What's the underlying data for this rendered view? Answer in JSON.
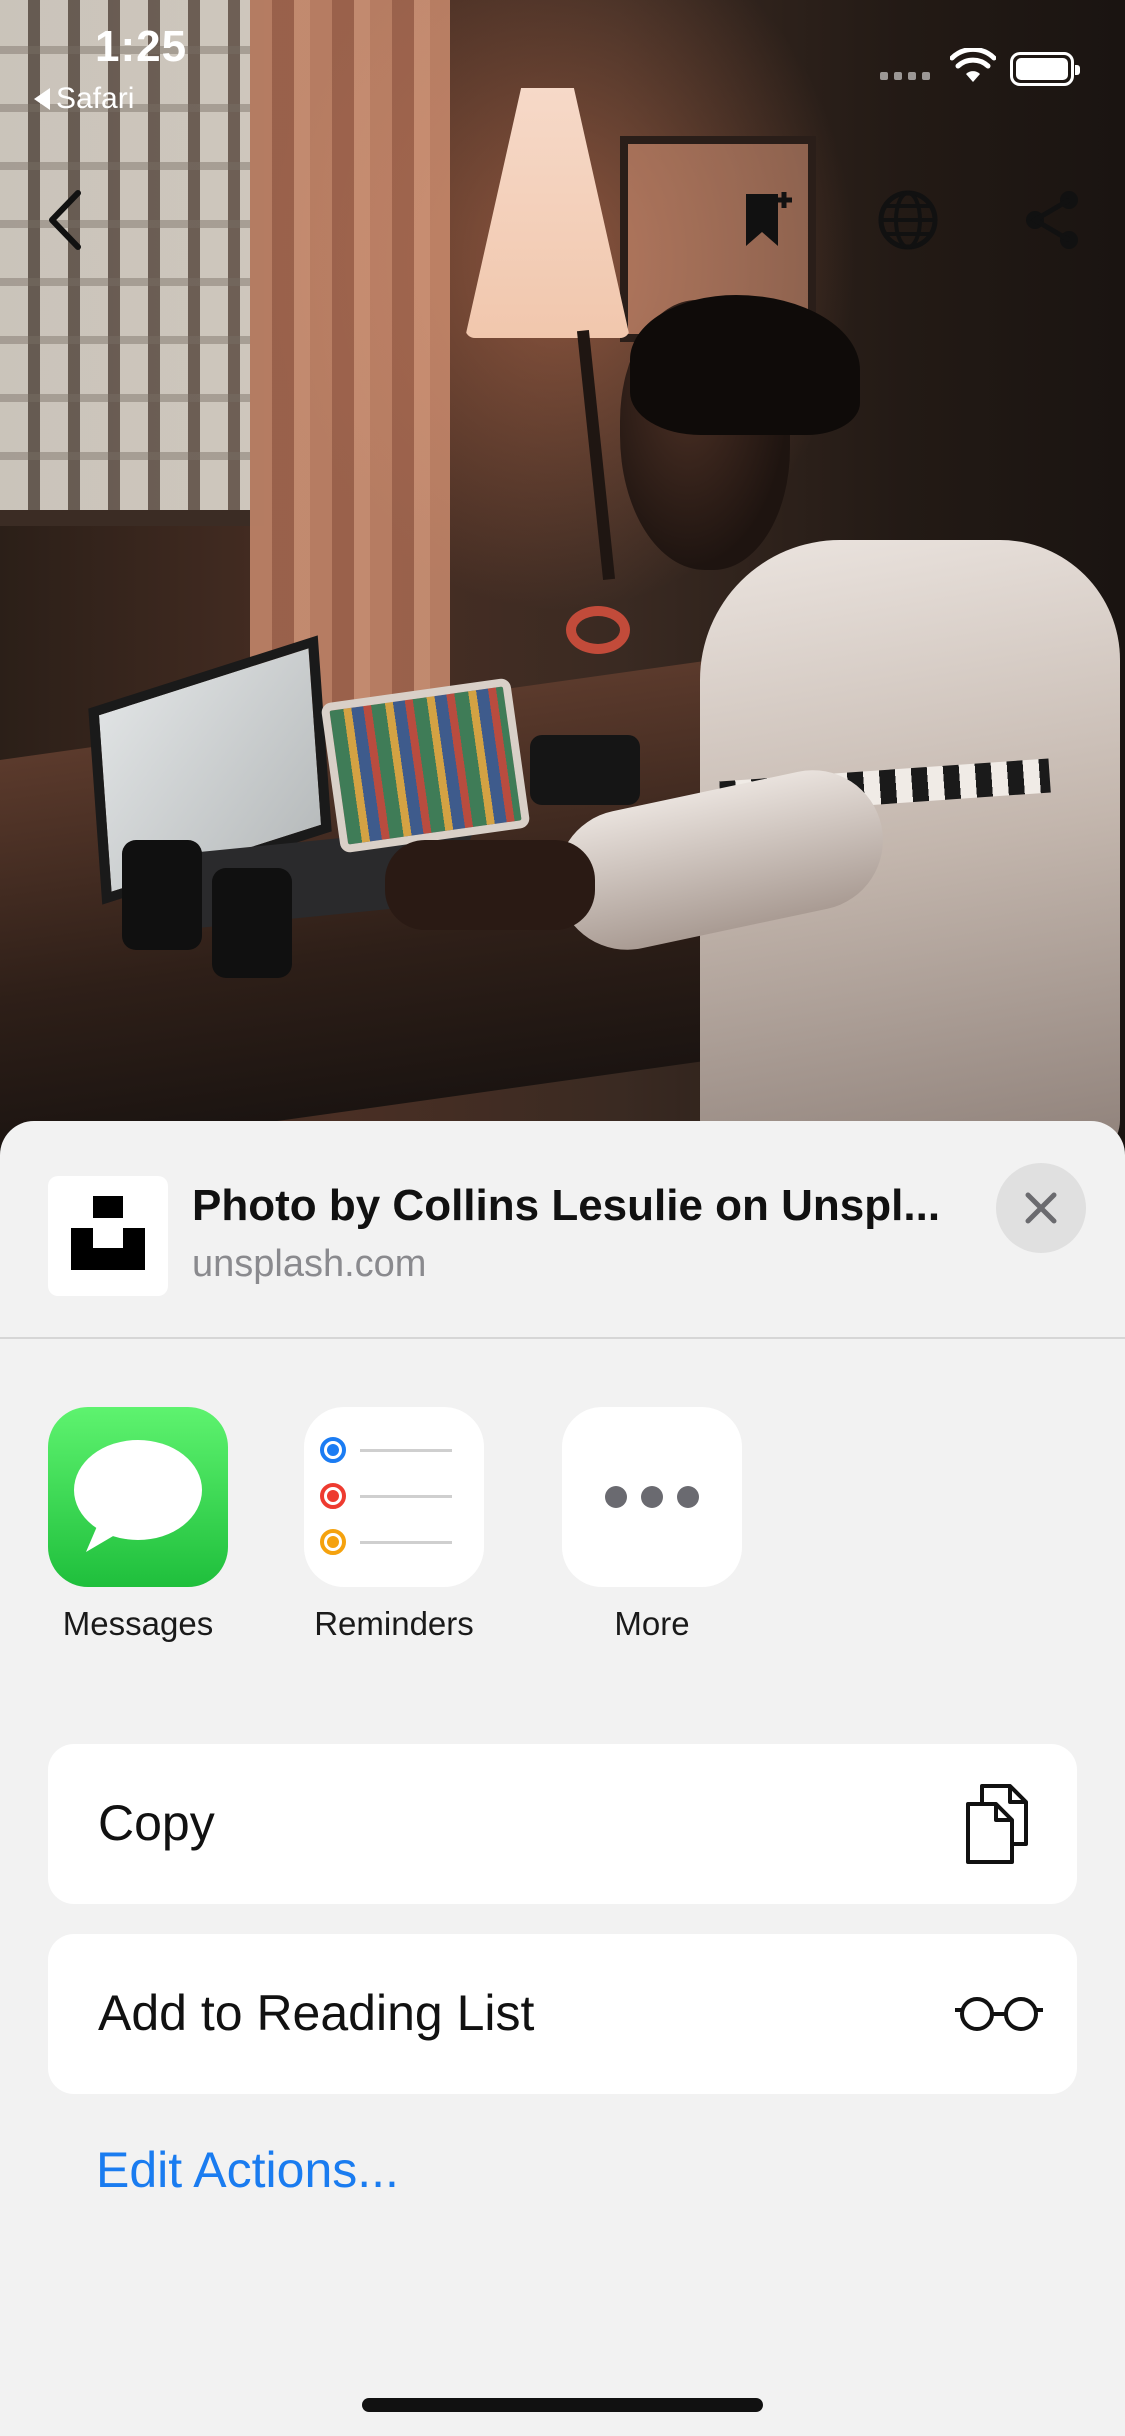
{
  "status_bar": {
    "time": "1:25",
    "back_app": "Safari"
  },
  "photo_toolbar": {
    "icons": [
      "back-chevron-icon",
      "bookmark-add-icon",
      "globe-icon",
      "share-icon"
    ]
  },
  "share_sheet": {
    "title": "Photo by Collins Lesulie on Unspl...",
    "url": "unsplash.com",
    "apps": [
      {
        "label": "Messages",
        "icon": "messages-icon"
      },
      {
        "label": "Reminders",
        "icon": "reminders-icon"
      },
      {
        "label": "More",
        "icon": "more-icon"
      }
    ],
    "actions": [
      {
        "label": "Copy",
        "icon": "copy-icon"
      },
      {
        "label": "Add to Reading List",
        "icon": "reading-list-glasses-icon"
      }
    ],
    "edit_actions": "Edit Actions..."
  },
  "colors": {
    "accent": "#1a7cf0",
    "messages_green": "#2ccf4a",
    "reminder_blue": "#1b7cf3",
    "reminder_red": "#ee3b30",
    "reminder_orange": "#f5a20e"
  }
}
